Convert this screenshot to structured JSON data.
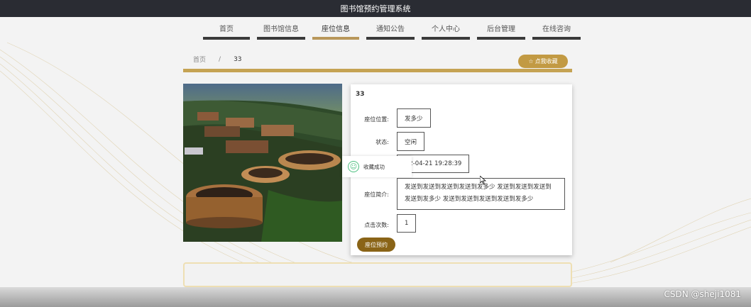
{
  "app": {
    "title": "图书馆预约管理系统"
  },
  "nav": {
    "items": [
      {
        "label": "首页"
      },
      {
        "label": "图书馆信息"
      },
      {
        "label": "座位信息"
      },
      {
        "label": "通知公告"
      },
      {
        "label": "个人中心"
      },
      {
        "label": "后台管理"
      },
      {
        "label": "在线咨询"
      }
    ],
    "active": "座位信息"
  },
  "breadcrumb": {
    "home": "首页",
    "separator": "/",
    "current": "33"
  },
  "favorite_button": {
    "icon": "star-outline-icon",
    "label": "点我收藏"
  },
  "detail": {
    "title": "33",
    "location_label": "座位位置:",
    "location_value": "发多少",
    "status_label": "状态:",
    "status_value": "空闲",
    "time_value": "2022-04-21 19:28:39",
    "intro_label": "座位简介:",
    "intro_value": "发送到发送到发送到发送到发多少 发送到发送到发送到发送到发多少 发送到发送到发送到发送到发多少",
    "clicks_label": "点击次数:",
    "clicks_value": "1",
    "reserve_button": "座位预约"
  },
  "toast": {
    "icon": "smile-icon",
    "message": "收藏成功"
  },
  "watermark": "CSDN @sheji1081",
  "colors": {
    "topbar": "#2a2c33",
    "accent_gold": "#c5a353",
    "favorite_button": "#c29a43",
    "reserve_button": "#8a6417",
    "toast_icon": "#4cbf7f"
  }
}
